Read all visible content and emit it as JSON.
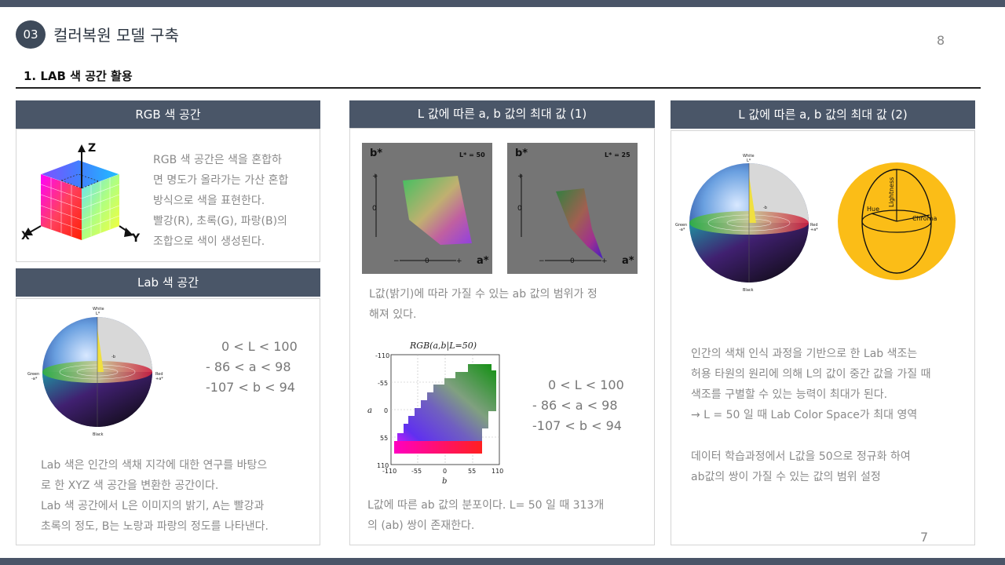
{
  "header": {
    "section_number": "03",
    "section_title": "컬러복원 모델 구축",
    "page_top": "8",
    "page_bottom": "7",
    "subheading": "1. LAB 색 공간 활용"
  },
  "rgb_panel": {
    "title": "RGB 색 공간",
    "lines": [
      "RGB 색 공간은 색을 혼합하",
      "면 명도가 올라가는 가산 혼합",
      "방식으로 색을 표현한다.",
      "빨강(R), 초록(G), 파랑(B)의",
      "조합으로 색이 생성된다."
    ],
    "axis_z": "Z",
    "axis_x": "X",
    "axis_y": "Y"
  },
  "lab_panel": {
    "title": "Lab 색 공간",
    "ranges": [
      "0 < L < 100",
      "- 86 < a < 98",
      "-107 < b < 94"
    ],
    "sphere_labels": {
      "white": "White",
      "l": "L*",
      "green": "Green",
      "neg_a": "-a*",
      "red": "Red",
      "pos_a": "+a*",
      "black": "Black",
      "neg_b": "-b"
    },
    "lines": [
      "Lab 색은 인간의 색채 지각에 대한 연구를 바탕으",
      "로 한 XYZ 색 공간을 변환한 공간이다.",
      "Lab 색 공간에서 L은 이미지의 밝기, A는 빨강과",
      "초록의 정도, B는 노랑과 파랑의 정도를 나타낸다."
    ]
  },
  "l1_panel": {
    "title": "L 값에 따른 a, b 값의 최대 값 (1)",
    "plot1": {
      "b_label": "b*",
      "a_label": "a*",
      "l_label": "L* = 50",
      "zero": "0",
      "plus": "+",
      "minus": "−"
    },
    "plot2": {
      "b_label": "b*",
      "a_label": "a*",
      "l_label": "L* = 25",
      "zero": "0",
      "plus": "+",
      "minus": "−"
    },
    "text1": [
      "L값(밝기)에 따라 가질 수 있는 ab 값의 범위가 정",
      "해져 있다."
    ],
    "chart_title": "RGB(a,b|L=50)",
    "chart_xlabel": "b",
    "chart_ylabel": "a",
    "chart_yticks": [
      "-110",
      "-55",
      "0",
      "55",
      "110"
    ],
    "chart_xticks": [
      "-110",
      "-55",
      "0",
      "55",
      "110"
    ],
    "ranges": [
      "0 < L < 100",
      "- 86 < a < 98",
      "-107 < b < 94"
    ],
    "text2": [
      "L값에 따른 ab 값의 분포이다. L= 50 일 때 313개",
      "의 (ab) 쌍이 존재한다."
    ]
  },
  "l2_panel": {
    "title": "L 값에 따른 a, b 값의 최대 값 (2)",
    "sphere_labels": {
      "white": "White",
      "l": "L*",
      "green": "Green",
      "neg_a": "-a*",
      "red": "Red",
      "pos_a": "+a*",
      "black": "Black",
      "neg_b": "-b"
    },
    "ellipse_labels": {
      "lightness": "Lightness",
      "hue": "Hue",
      "chroma": "Chroma"
    },
    "text1": [
      "인간의 색채 인식 과정을 기반으로 한 Lab 색조는",
      "허용 타원의 원리에 의해 L의 값이 중간 값을 가질 때",
      "색조를 구별할 수 있는 능력이 최대가 된다.",
      "→ L = 50 일 때 Lab Color Space가 최대 영역"
    ],
    "text2": [
      "데이터 학습과정에서 L값을 50으로 정규화 하여",
      "ab값의 쌍이 가질 수 있는 값의 범위 설정"
    ]
  },
  "colors": {
    "header_bg": "#4a5668",
    "accent_yellow": "#fbbd17",
    "bar": "#4a5568"
  }
}
